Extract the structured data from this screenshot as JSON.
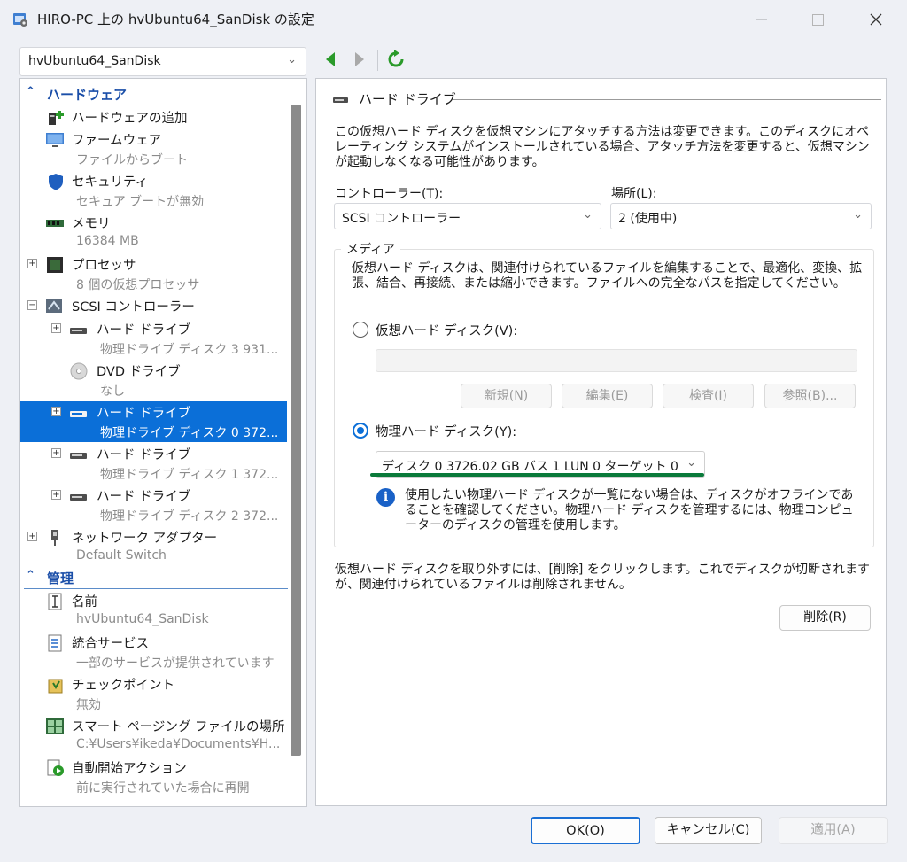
{
  "window": {
    "title": "HIRO-PC 上の hvUbuntu64_SanDisk の設定",
    "minimize": "—",
    "maximize": "☐",
    "close": "✕"
  },
  "vm_selector": {
    "value": "hvUbuntu64_SanDisk",
    "chevron": "⌄"
  },
  "nav": {
    "back_icon": "back-arrow-icon",
    "forward_icon": "forward-arrow-icon",
    "refresh_icon": "refresh-icon"
  },
  "sidebar": {
    "hardware_header": "ハードウェア",
    "management_header": "管理",
    "items": [
      {
        "label": "ハードウェアの追加",
        "sub": ""
      },
      {
        "label": "ファームウェア",
        "sub": "ファイルからブート"
      },
      {
        "label": "セキュリティ",
        "sub": "セキュア ブートが無効"
      },
      {
        "label": "メモリ",
        "sub": "16384 MB"
      },
      {
        "label": "プロセッサ",
        "sub": "8 個の仮想プロセッサ"
      },
      {
        "label": "SCSI コントローラー",
        "sub": ""
      },
      {
        "label": "ハード ドライブ",
        "sub": "物理ドライブ ディスク 3 931..."
      },
      {
        "label": "DVD ドライブ",
        "sub": "なし"
      },
      {
        "label": "ハード ドライブ",
        "sub": "物理ドライブ ディスク 0 372..."
      },
      {
        "label": "ハード ドライブ",
        "sub": "物理ドライブ ディスク 1 372..."
      },
      {
        "label": "ハード ドライブ",
        "sub": "物理ドライブ ディスク 2 372..."
      },
      {
        "label": "ネットワーク アダプター",
        "sub": "Default Switch"
      },
      {
        "label": "名前",
        "sub": "hvUbuntu64_SanDisk"
      },
      {
        "label": "統合サービス",
        "sub": "一部のサービスが提供されています"
      },
      {
        "label": "チェックポイント",
        "sub": "無効"
      },
      {
        "label": "スマート ページング ファイルの場所",
        "sub": "C:¥Users¥ikeda¥Documents¥H..."
      },
      {
        "label": "自動開始アクション",
        "sub": "前に実行されていた場合に再開"
      }
    ]
  },
  "panel": {
    "group_title": "ハード ドライブ",
    "description": "この仮想ハード ディスクを仮想マシンにアタッチする方法は変更できます。このディスクにオペレーティング システムがインストールされている場合、アタッチ方法を変更すると、仮想マシンが起動しなくなる可能性があります。",
    "controller_label": "コントローラー(T):",
    "controller_value": "SCSI コントローラー",
    "location_label": "場所(L):",
    "location_value": "2 (使用中)",
    "media_title": "メディア",
    "media_description": "仮想ハード ディスクは、関連付けられているファイルを編集することで、最適化、変換、拡張、結合、再接続、または縮小できます。ファイルへの完全なパスを指定してください。",
    "virtual_disk_label": "仮想ハード ディスク(V):",
    "virtual_disk_path": "",
    "btn_new": "新規(N)",
    "btn_edit": "編集(E)",
    "btn_inspect": "検査(I)",
    "btn_browse": "参照(B)...",
    "physical_disk_label": "物理ハード ディスク(Y):",
    "physical_disk_value": "ディスク 0 3726.02 GB バス 1 LUN 0 ターゲット 0",
    "info_text": "使用したい物理ハード ディスクが一覧にない場合は、ディスクがオフラインであることを確認してください。物理ハード ディスクを管理するには、物理コンピューターのディスクの管理を使用します。",
    "remove_description": "仮想ハード ディスクを取り外すには、[削除] をクリックします。これでディスクが切断されますが、関連付けられているファイルは削除されません。",
    "btn_remove": "削除(R)"
  },
  "footer": {
    "ok": "OK(O)",
    "cancel": "キャンセル(C)",
    "apply": "適用(A)"
  },
  "colors": {
    "accent": "#0b6fd8",
    "header_text": "#1a4ea8",
    "highlight_underline": "#0a7a3a"
  }
}
